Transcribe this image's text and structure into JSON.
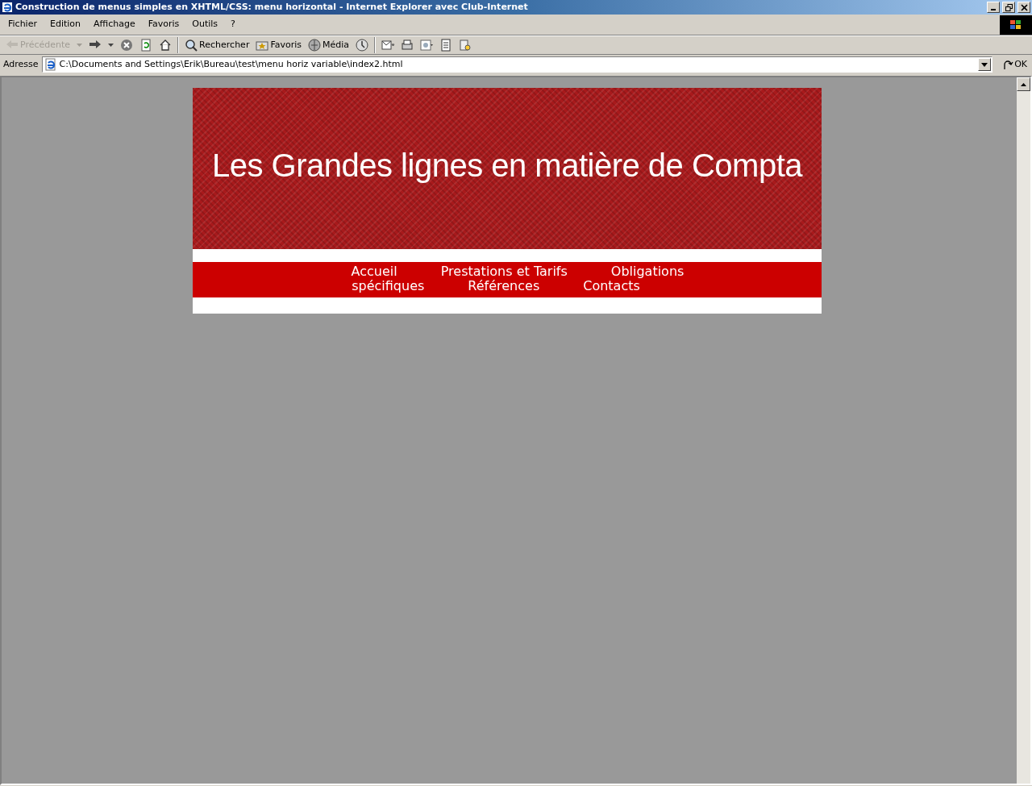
{
  "window": {
    "title": "Construction de menus simples en XHTML/CSS: menu horizontal - Internet Explorer avec Club-Internet"
  },
  "menu_bar": [
    "Fichier",
    "Edition",
    "Affichage",
    "Favoris",
    "Outils",
    "?"
  ],
  "toolbar": [
    {
      "kind": "back",
      "label": "Précédente",
      "disabled": true
    },
    {
      "kind": "forward",
      "disabled": false
    },
    {
      "kind": "stop",
      "disabled": false
    },
    {
      "kind": "refresh",
      "disabled": false
    },
    {
      "kind": "home",
      "disabled": false
    },
    {
      "kind": "search",
      "label": "Rechercher",
      "disabled": false
    },
    {
      "kind": "favorites",
      "label": "Favoris",
      "disabled": false
    },
    {
      "kind": "media",
      "label": "Média",
      "disabled": false
    },
    {
      "kind": "history",
      "disabled": false
    },
    {
      "kind": "mail",
      "disabled": false
    },
    {
      "kind": "print",
      "disabled": false
    },
    {
      "kind": "messenger",
      "disabled": false
    },
    {
      "kind": "edit",
      "disabled": false
    },
    {
      "kind": "research",
      "disabled": false
    }
  ],
  "address_bar": {
    "label": "Adresse",
    "value": "C:\\Documents and Settings\\Erik\\Bureau\\test\\menu horiz variable\\index2.html",
    "go_button": "OK"
  },
  "page": {
    "banner_title": "Les Grandes lignes en matière de Compta",
    "nav_rows": [
      [
        "Accueil",
        "Prestations et Tarifs",
        "Obligations"
      ],
      [
        "spécifiques",
        "Références",
        "Contacts"
      ]
    ]
  }
}
